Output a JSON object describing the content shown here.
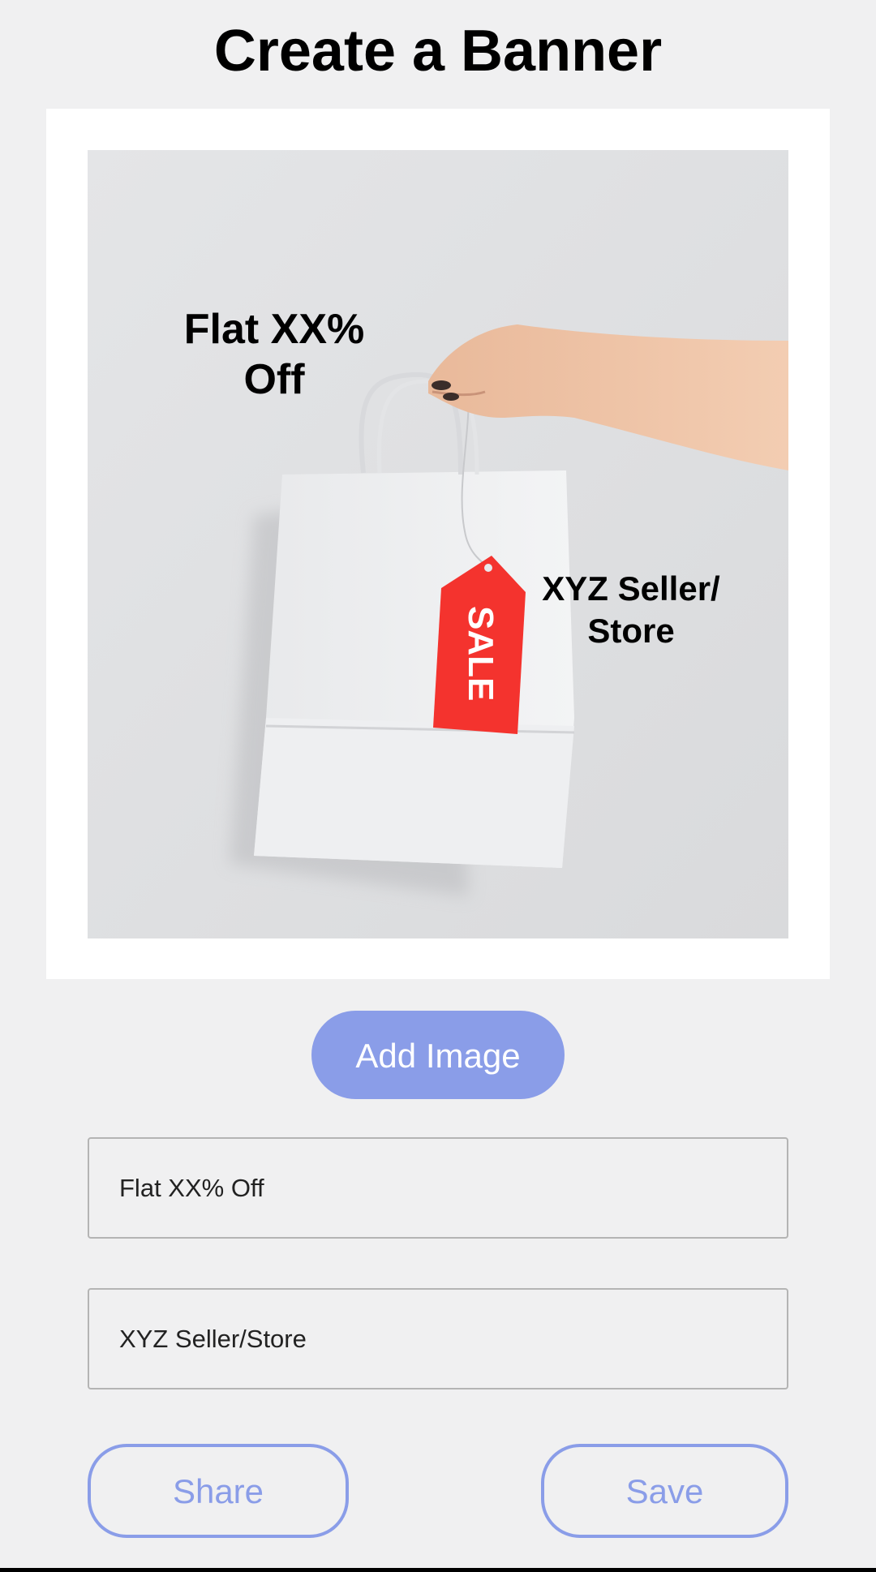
{
  "header": {
    "title": "Create a Banner"
  },
  "banner": {
    "discount_text": "Flat XX%\nOff",
    "store_text": "XYZ Seller/\nStore",
    "tag_text": "SALE"
  },
  "actions": {
    "add_image_label": "Add Image"
  },
  "form": {
    "discount_value": "Flat XX% Off",
    "store_value": "XYZ Seller/Store"
  },
  "footer": {
    "share_label": "Share",
    "save_label": "Save"
  },
  "colors": {
    "accent": "#8a9de8",
    "background": "#f0f0f1",
    "tag_red": "#f4332e"
  }
}
